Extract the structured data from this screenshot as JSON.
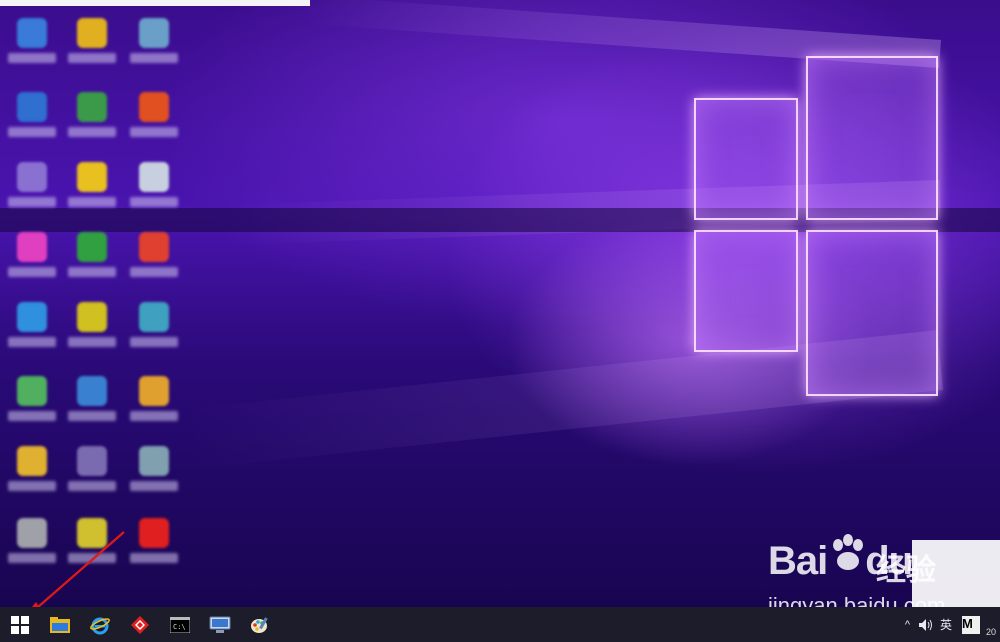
{
  "desktop": {
    "wallpaper": "windows-10-hero-purple",
    "accent": "#6a24d8",
    "icons": [
      {
        "name": "desktop-icon-1",
        "color": "#3a7ad8"
      },
      {
        "name": "desktop-icon-2",
        "color": "#e0b020"
      },
      {
        "name": "desktop-icon-3",
        "color": "#6aa0c8"
      },
      {
        "name": "desktop-icon-4",
        "color": "#2f6fd0"
      },
      {
        "name": "desktop-icon-5",
        "color": "#3a9a4a"
      },
      {
        "name": "desktop-icon-6",
        "color": "#e05020"
      },
      {
        "name": "desktop-icon-7",
        "color": "#8a70d0"
      },
      {
        "name": "desktop-icon-8",
        "color": "#e8c020"
      },
      {
        "name": "desktop-icon-9",
        "color": "#c8d0e0"
      },
      {
        "name": "desktop-icon-10",
        "color": "#e040c0"
      },
      {
        "name": "desktop-icon-11",
        "color": "#30a040"
      },
      {
        "name": "desktop-icon-12",
        "color": "#e04030"
      },
      {
        "name": "desktop-icon-13",
        "color": "#3090e0"
      },
      {
        "name": "desktop-icon-14",
        "color": "#d0c020"
      },
      {
        "name": "desktop-icon-15",
        "color": "#40a0c0"
      },
      {
        "name": "desktop-icon-16",
        "color": "#50b060"
      },
      {
        "name": "desktop-icon-17",
        "color": "#3a80d0"
      },
      {
        "name": "desktop-icon-18",
        "color": "#e0a030"
      },
      {
        "name": "desktop-icon-19",
        "color": "#e0b030"
      },
      {
        "name": "desktop-icon-20",
        "color": "#7a6ab0"
      },
      {
        "name": "desktop-icon-21",
        "color": "#80a0b0"
      },
      {
        "name": "desktop-icon-22",
        "color": "#a0a0a8"
      },
      {
        "name": "desktop-icon-23",
        "color": "#d0c030"
      },
      {
        "name": "desktop-icon-24",
        "color": "#e02020"
      }
    ]
  },
  "watermark": {
    "brand": "Bai",
    "brand2": "du",
    "sub": "经验",
    "url": "jingyan.baidu.com"
  },
  "taskbar": {
    "start": "start-icon",
    "apps": [
      "file-explorer-icon",
      "internet-explorer-icon",
      "app-red-icon",
      "command-prompt-icon",
      "network-icon",
      "paint-icon"
    ],
    "tray": {
      "chevron": "^",
      "volume": "volume-icon",
      "ime": "英",
      "m_badge": "M",
      "clock": "20"
    }
  }
}
